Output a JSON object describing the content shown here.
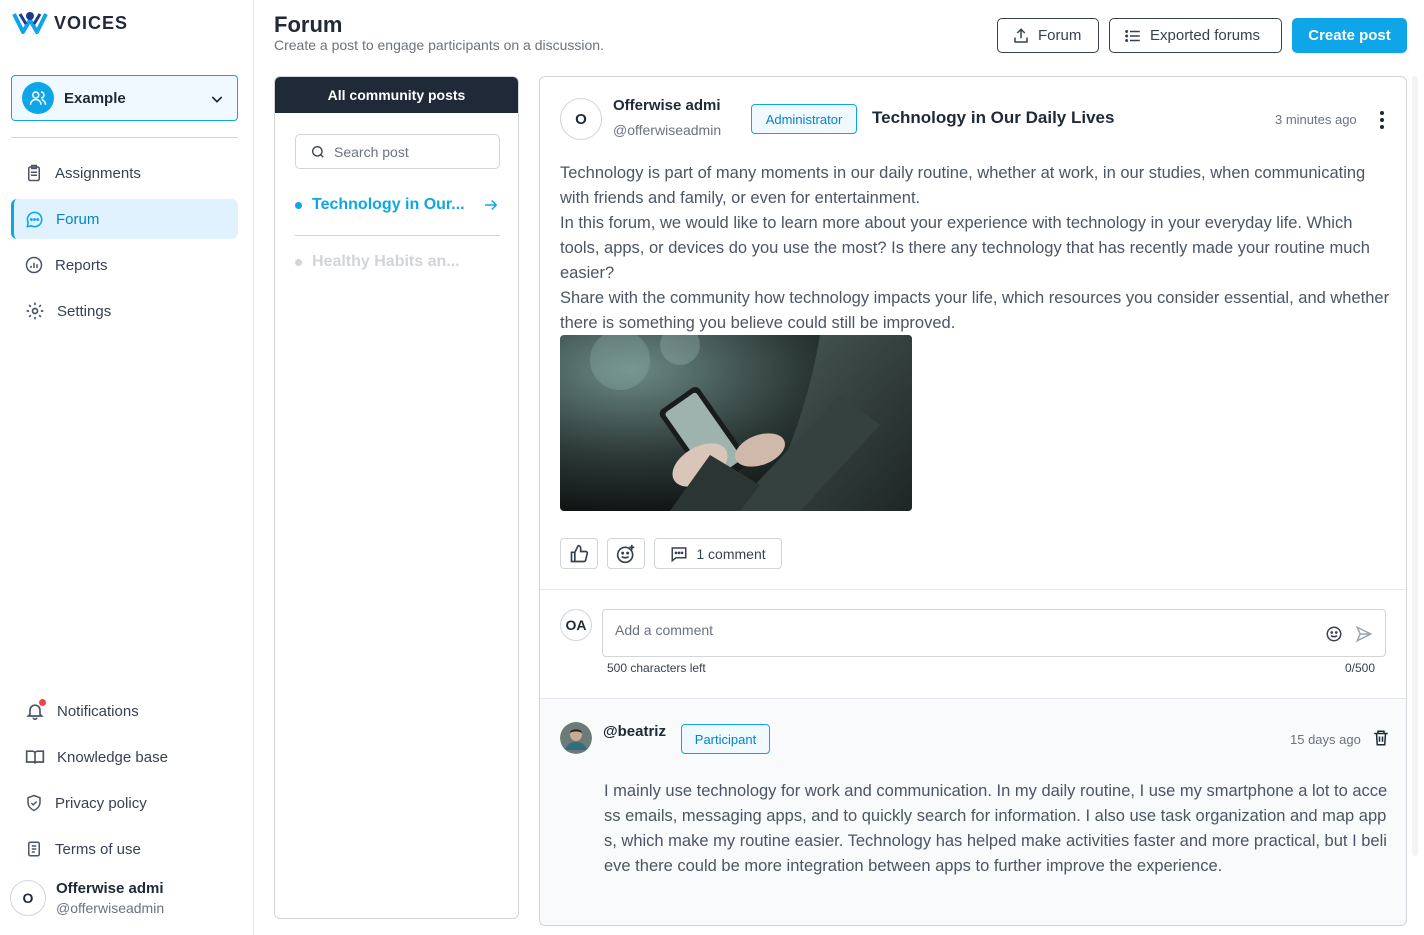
{
  "brand": {
    "name": "VOICES"
  },
  "sidebar": {
    "project": {
      "label": "Example"
    },
    "nav": [
      {
        "label": "Assignments",
        "icon": "clipboard-icon"
      },
      {
        "label": "Forum",
        "icon": "chat-icon",
        "active": true
      },
      {
        "label": "Reports",
        "icon": "chart-icon"
      },
      {
        "label": "Settings",
        "icon": "gear-icon"
      }
    ],
    "bottom_nav": [
      {
        "label": "Notifications",
        "icon": "bell-icon"
      },
      {
        "label": "Knowledge base",
        "icon": "book-icon"
      },
      {
        "label": "Privacy policy",
        "icon": "shield-icon"
      },
      {
        "label": "Terms of use",
        "icon": "document-icon"
      }
    ],
    "user": {
      "initial": "O",
      "name": "Offerwise admi",
      "handle": "@offerwiseadmin"
    }
  },
  "header": {
    "title": "Forum",
    "subtitle": "Create a post to engage participants on a discussion.",
    "forum_button": "Forum",
    "exported_button": "Exported forums",
    "create_button": "Create post"
  },
  "posts_panel": {
    "title": "All community posts",
    "search_placeholder": "Search post",
    "items": [
      {
        "label": "Technology in Our...",
        "active": true
      },
      {
        "label": "Healthy Habits an...",
        "active": false
      }
    ]
  },
  "post": {
    "author_initial": "O",
    "author_name": "Offerwise admi",
    "author_handle": "@offerwiseadmin",
    "role": "Administrator",
    "title": "Technology in Our Daily Lives",
    "time": "3 minutes ago",
    "body": [
      "Technology is part of many moments in our daily routine, whether at work, in our studies, when communicating with friends and family, or even for entertainment.",
      "In this forum, we would like to learn more about your experience with technology in your everyday life. Which tools, apps, or devices do you use the most? Is there any technology that has recently made your routine much easier?",
      "Share with the community how technology impacts your life, which resources you consider essential, and whether there is something you believe could still be improved."
    ],
    "comment_count_label": "1 comment"
  },
  "comment_box": {
    "avatar": "OA",
    "placeholder": "Add a comment",
    "chars_left": "500 characters left",
    "counter": "0/500"
  },
  "comments": [
    {
      "handle": "@beatriz",
      "role": "Participant",
      "time": "15 days ago",
      "text": "I mainly use technology for work and communication. In my daily routine, I use my smartphone a lot to access emails, messaging apps, and to quickly search for information. I also use task organization and map apps, which make my routine easier. Technology has helped make activities faster and more practical, but I believe there could be more integration between apps to further improve the experience."
    }
  ],
  "colors": {
    "accent": "#0ea5e9",
    "dark": "#1f2937",
    "notification_dot": "#ef4444"
  }
}
